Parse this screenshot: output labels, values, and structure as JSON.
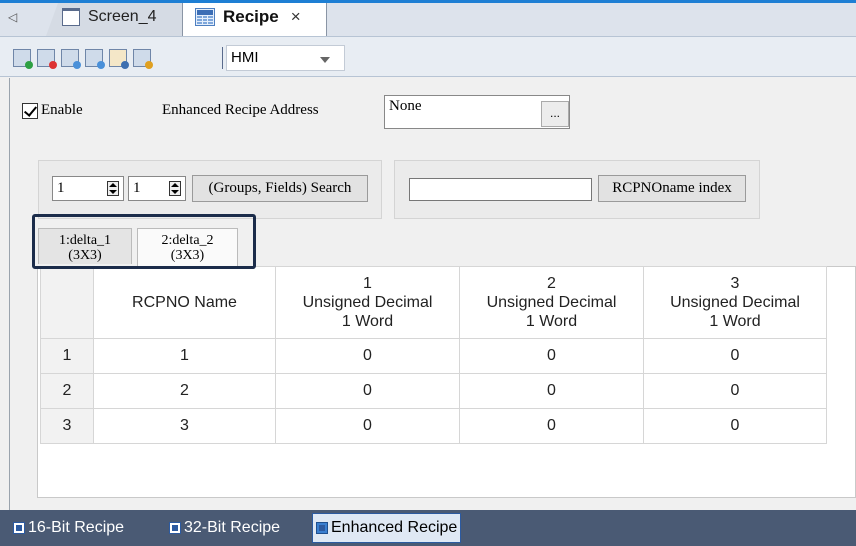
{
  "tabs": {
    "scroll_left": "◁",
    "screen_tab": "Screen_4",
    "recipe_tab": "Recipe",
    "close": "×"
  },
  "toolbar": {
    "icons": [
      "add-recipe-icon",
      "delete-recipe-icon",
      "import-icon",
      "export-icon",
      "brush-icon",
      "edit-icon"
    ],
    "device_select": "HMI"
  },
  "settings": {
    "enable_label": "Enable",
    "enable_checked": true,
    "enhanced_address_label": "Enhanced Recipe Address",
    "address_value": "None",
    "browse_button": "..."
  },
  "search": {
    "groups_value": "1",
    "fields_value": "1",
    "search_button": "(Groups, Fields) Search",
    "rcpno_value": "",
    "rcpno_index_button": "RCPNOname index"
  },
  "sheet_tabs": [
    {
      "line1": "1:delta_1",
      "line2": "(3X3)"
    },
    {
      "line1": "2:delta_2",
      "line2": "(3X3)"
    }
  ],
  "table": {
    "name_header": "RCPNO Name",
    "columns": [
      {
        "num": "1",
        "type": "Unsigned Decimal",
        "size": "1 Word"
      },
      {
        "num": "2",
        "type": "Unsigned Decimal",
        "size": "1 Word"
      },
      {
        "num": "3",
        "type": "Unsigned Decimal",
        "size": "1 Word"
      }
    ],
    "rows": [
      {
        "index": "1",
        "name": "1",
        "values": [
          "0",
          "0",
          "0"
        ]
      },
      {
        "index": "2",
        "name": "2",
        "values": [
          "0",
          "0",
          "0"
        ]
      },
      {
        "index": "3",
        "name": "3",
        "values": [
          "0",
          "0",
          "0"
        ]
      }
    ]
  },
  "bottom_tabs": {
    "tab16": "16-Bit Recipe",
    "tab32": "32-Bit Recipe",
    "tab_enhanced": "Enhanced Recipe"
  }
}
